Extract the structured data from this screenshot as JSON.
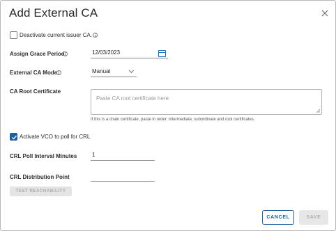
{
  "dialog": {
    "title": "Add External CA",
    "close_icon": "close-icon"
  },
  "deactivate": {
    "label": "Deactivate current issuer CA.",
    "checked": false
  },
  "grace_period": {
    "label": "Assign Grace Period",
    "value": "12/03/2023",
    "icon": "calendar-icon"
  },
  "ca_mode": {
    "label": "External CA Mode",
    "value": "Manual"
  },
  "root_cert": {
    "label": "CA Root Certificate",
    "placeholder": "Paste CA root certificate here",
    "help": "If this is a chain certificate, paste in order: intermediate, subordinate and root certificates."
  },
  "vco_poll": {
    "label": "Activate VCO to poll for CRL",
    "checked": true
  },
  "crl_interval": {
    "label": "CRL Poll Interval Minutes",
    "value": "1"
  },
  "crl_distribution": {
    "label": "CRL Distribution Point",
    "value": ""
  },
  "buttons": {
    "test_reachability": "TEST REACHABILITY",
    "cancel": "CANCEL",
    "save": "SAVE"
  },
  "colors": {
    "accent": "#1a5ea6",
    "disabled_bg": "#e4e4e4",
    "border": "#b5b5b5"
  }
}
